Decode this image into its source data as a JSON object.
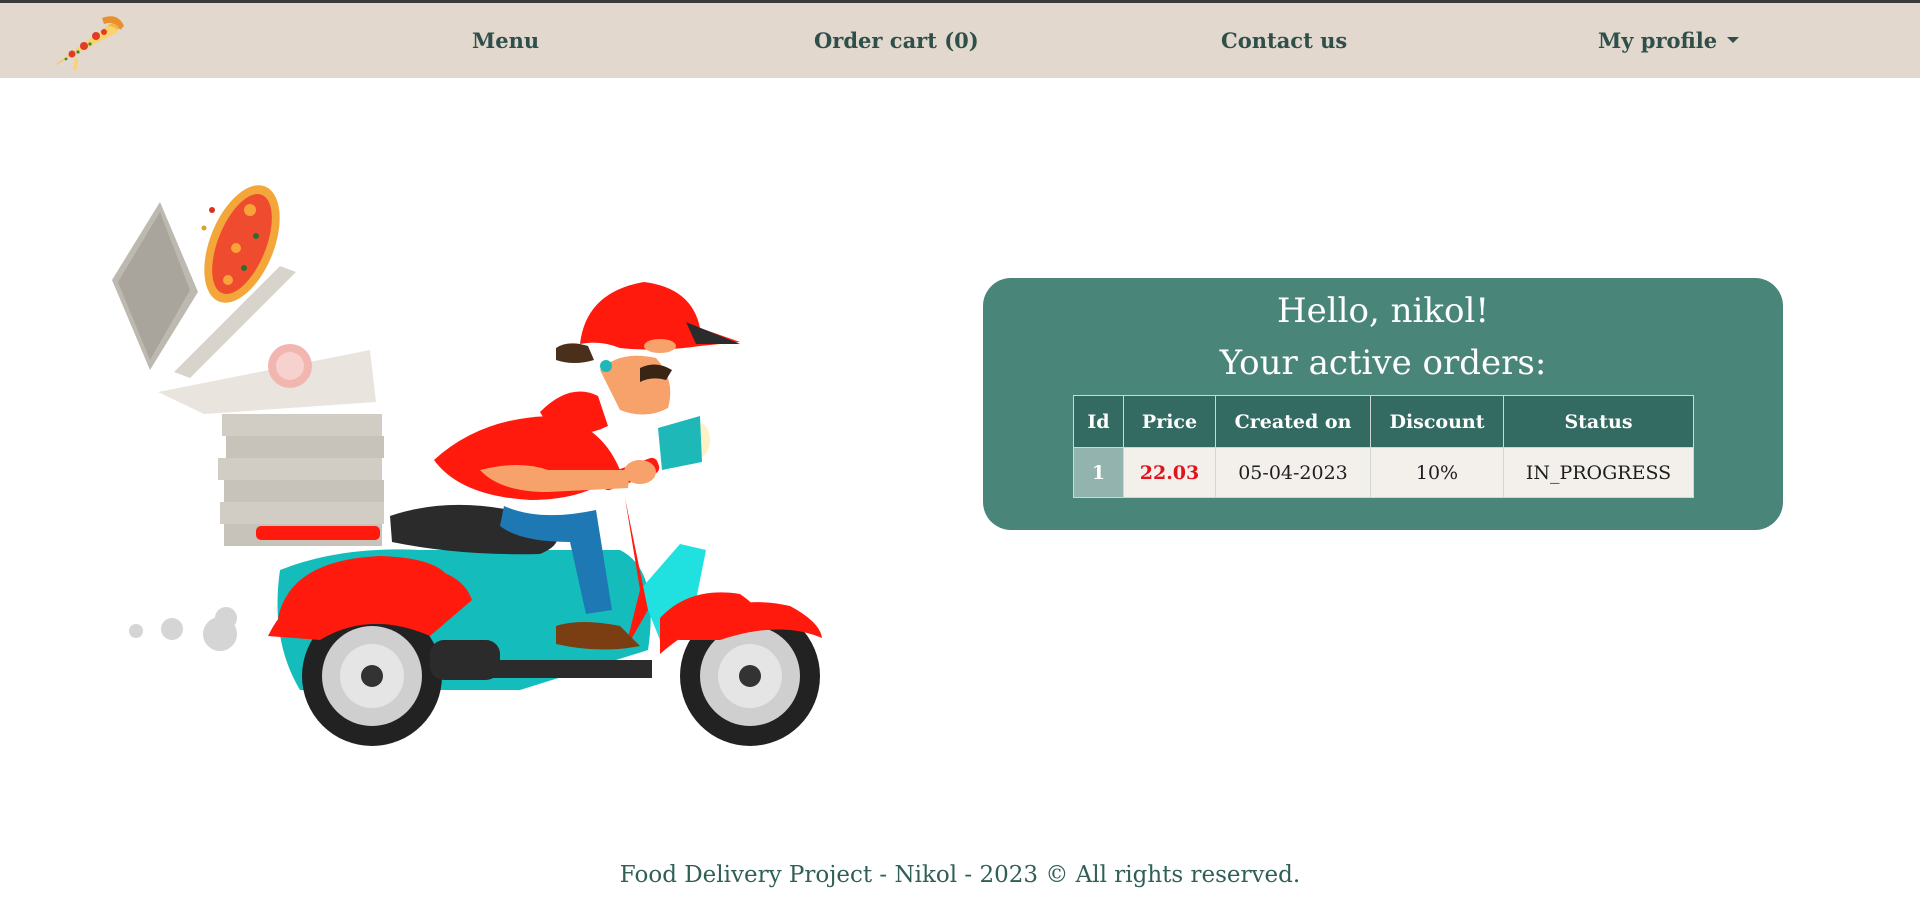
{
  "nav": {
    "logo_icon": "pizza-slice-icon",
    "menu": "Menu",
    "cart": "Order cart (0)",
    "contact": "Contact us",
    "profile": "My profile",
    "profile_icon": "chevron-down-icon"
  },
  "hero": {
    "illustration": "pizza-delivery-scooter-illustration"
  },
  "panel": {
    "greeting": "Hello, nikol!",
    "subtitle": "Your active orders:",
    "table": {
      "headers": [
        "Id",
        "Price",
        "Created on",
        "Discount",
        "Status"
      ],
      "rows": [
        {
          "id": "1",
          "price": "22.03",
          "created_on": "05-04-2023",
          "discount": "10%",
          "status": "IN_PROGRESS"
        }
      ]
    }
  },
  "footer": {
    "text": "Food Delivery Project - Nikol - 2023 © All rights reserved."
  },
  "colors": {
    "navbar_bg": "#e3d8cd",
    "nav_text": "#2f4f4a",
    "panel_bg": "#4a857a",
    "table_header_bg": "#336a62",
    "price_red": "#e0141e"
  }
}
